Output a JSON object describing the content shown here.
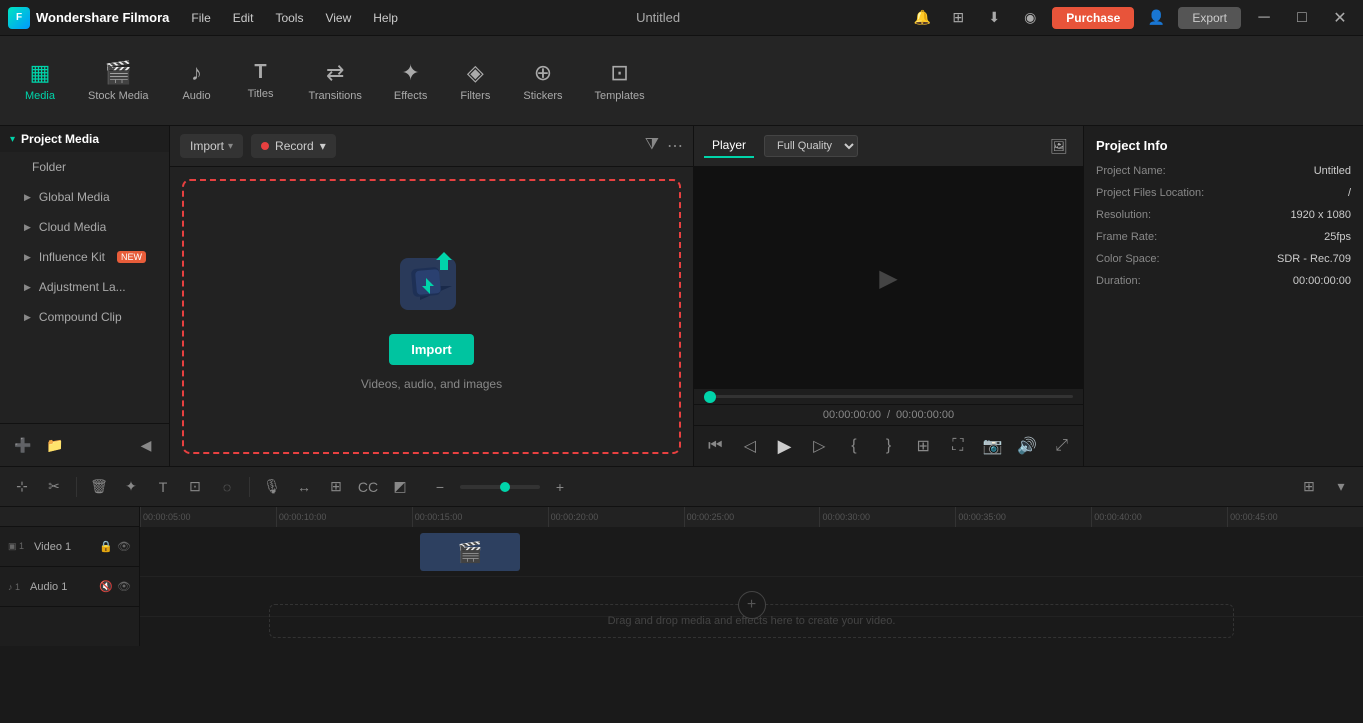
{
  "app": {
    "name": "Wondershare Filmora",
    "title": "Untitled",
    "logo_icon": "F"
  },
  "titlebar": {
    "menus": [
      "File",
      "Edit",
      "Tools",
      "View",
      "Help"
    ],
    "purchase_label": "Purchase",
    "export_label": "Export",
    "window_title": "Untitled",
    "icons": [
      "minimize",
      "maximize",
      "close"
    ]
  },
  "toolbar": {
    "items": [
      {
        "id": "media",
        "label": "Media",
        "icon": "▦",
        "active": true
      },
      {
        "id": "stock-media",
        "label": "Stock Media",
        "icon": "🎬"
      },
      {
        "id": "audio",
        "label": "Audio",
        "icon": "♪"
      },
      {
        "id": "titles",
        "label": "Titles",
        "icon": "T"
      },
      {
        "id": "transitions",
        "label": "Transitions",
        "icon": "⇄"
      },
      {
        "id": "effects",
        "label": "Effects",
        "icon": "✦"
      },
      {
        "id": "filters",
        "label": "Filters",
        "icon": "◈"
      },
      {
        "id": "stickers",
        "label": "Stickers",
        "icon": "⊕"
      },
      {
        "id": "templates",
        "label": "Templates",
        "icon": "⊡"
      }
    ]
  },
  "left_panel": {
    "header": "Project Media",
    "items": [
      {
        "label": "Folder"
      },
      {
        "label": "Global Media"
      },
      {
        "label": "Cloud Media"
      },
      {
        "label": "Influence Kit",
        "badge": "NEW"
      },
      {
        "label": "Adjustment La..."
      },
      {
        "label": "Compound Clip"
      }
    ],
    "footer_icons": [
      "add-folder",
      "add-item",
      "collapse"
    ]
  },
  "media_panel": {
    "import_label": "Import",
    "record_label": "Record",
    "drop_import_label": "Import",
    "drop_hint": "Videos, audio, and images"
  },
  "player": {
    "tabs": [
      "Player"
    ],
    "quality": "Full Quality",
    "time_current": "00:00:00:00",
    "time_total": "00:00:00:00",
    "controls": [
      "prev",
      "step-back",
      "play",
      "step-fwd",
      "mark-in",
      "mark-out",
      "clip-nav",
      "fullscreen",
      "camera",
      "volume",
      "zoom"
    ]
  },
  "project_info": {
    "title": "Project Info",
    "name_label": "Project Name:",
    "name_value": "Untitled",
    "files_label": "Project Files Location:",
    "files_value": "/",
    "resolution_label": "Resolution:",
    "resolution_value": "1920 x 1080",
    "framerate_label": "Frame Rate:",
    "framerate_value": "25fps",
    "colorspace_label": "Color Space:",
    "colorspace_value": "SDR - Rec.709",
    "duration_label": "Duration:",
    "duration_value": "00:00:00:00"
  },
  "timeline": {
    "tools": [
      "select",
      "trim",
      "delete",
      "cut",
      "text",
      "crop",
      "mask"
    ],
    "zoom_minus": "−",
    "zoom_plus": "+",
    "ruler_marks": [
      "00:00:05:00",
      "00:00:10:00",
      "00:00:15:00",
      "00:00:20:00",
      "00:00:25:00",
      "00:00:30:00",
      "00:00:35:00",
      "00:00:40:00",
      "00:00:45:00"
    ],
    "video_track": "Video 1",
    "audio_track": "Audio 1",
    "drag_hint": "Drag and drop media and effects here to create your video."
  }
}
